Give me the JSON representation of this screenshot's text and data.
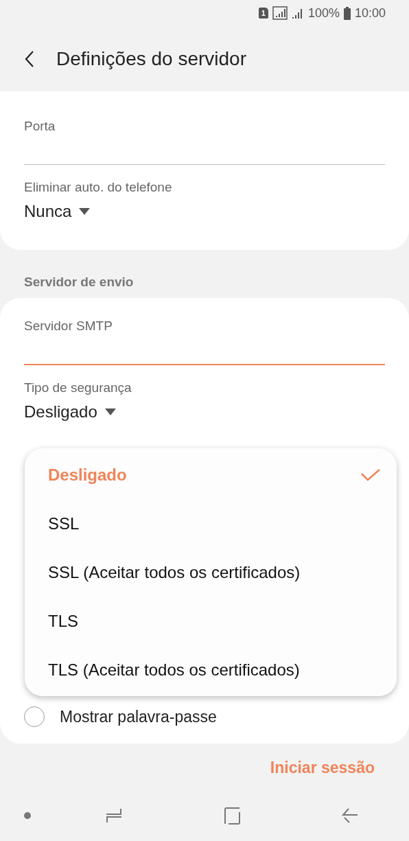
{
  "status_bar": {
    "sim": "1",
    "battery": "100%",
    "time": "10:00"
  },
  "header": {
    "title": "Definições do servidor"
  },
  "incoming": {
    "fields": [
      {
        "kind": "text",
        "label": "Porta",
        "focused": false
      },
      {
        "kind": "dropdown",
        "label": "Eliminar auto. do telefone",
        "value": "Nunca"
      }
    ]
  },
  "outgoing": {
    "title": "Servidor de envio",
    "fields": [
      {
        "kind": "text",
        "label": "Servidor SMTP",
        "focused": true
      },
      {
        "kind": "dropdown",
        "label": "Tipo de segurança",
        "value": "Desligado"
      }
    ],
    "show_password": {
      "label": "Mostrar palavra-passe",
      "checked": false
    }
  },
  "menu": {
    "options": [
      {
        "label": "Desligado",
        "selected": true
      },
      {
        "label": "SSL",
        "selected": false
      },
      {
        "label": "SSL (Aceitar todos os certificados)",
        "selected": false
      },
      {
        "label": "TLS",
        "selected": false
      },
      {
        "label": "TLS (Aceitar todos os certificados)",
        "selected": false
      }
    ]
  },
  "login_button": {
    "label": "Iniciar sessão"
  }
}
